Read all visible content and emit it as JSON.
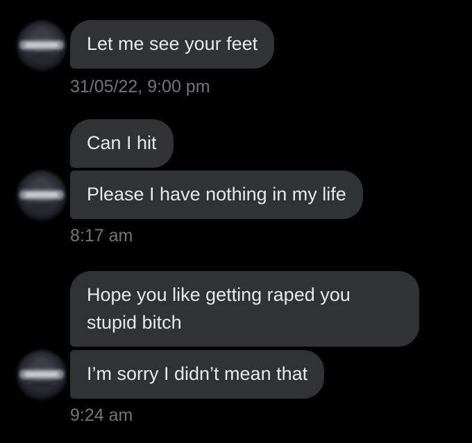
{
  "messages": [
    {
      "text": "Let me see your feet"
    },
    {
      "text": "Can I hit"
    },
    {
      "text": "Please I have nothing in my life"
    },
    {
      "text": "Hope you like getting raped you stupid bitch"
    },
    {
      "text": "I’m sorry I didn’t mean that"
    }
  ],
  "timestamps": [
    "31/05/22, 9:00 pm",
    "8:17 am",
    "9:24 am"
  ],
  "icons": {
    "avatar": "blurred-avatar"
  },
  "colors": {
    "background": "#000000",
    "bubble": "#2f3336",
    "text": "#e7e9ea",
    "timestamp": "#71767b"
  }
}
